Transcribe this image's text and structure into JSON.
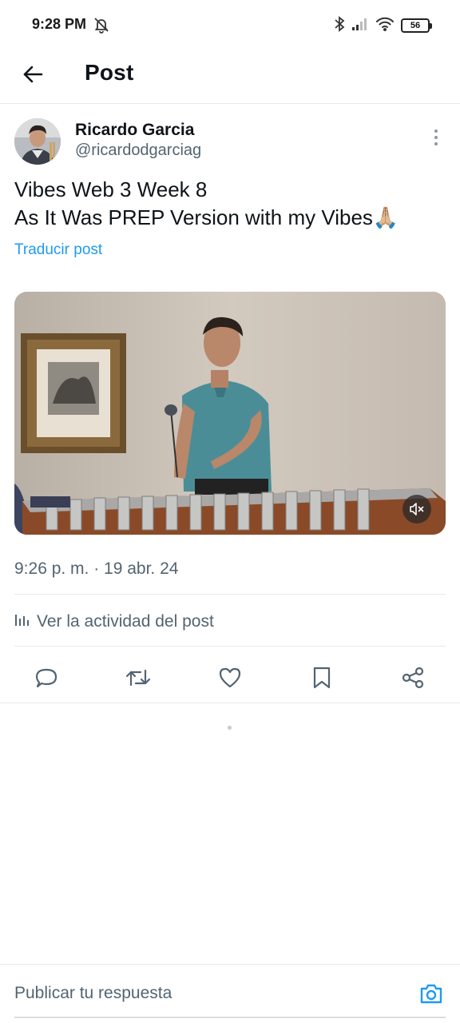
{
  "status_bar": {
    "time": "9:28 PM",
    "battery": "56",
    "icons": [
      "alarm-off-icon",
      "bluetooth-icon",
      "signal-icon",
      "wifi-icon",
      "battery-icon"
    ]
  },
  "header": {
    "title": "Post",
    "back_icon": "arrow-left-icon"
  },
  "post": {
    "author_name": "Ricardo Garcia",
    "author_handle": "@ricardodgarciag",
    "text_line1": "Vibes Web 3 Week 8",
    "text_line2": "As It Was PREP Version with my Vibes🙏🏼",
    "translate_label": "Traducir post",
    "timestamp": "9:26 p. m. · 19 abr. 24",
    "activity_label": "Ver la actividad del post"
  },
  "actions": {
    "icons": [
      "reply-icon",
      "repost-icon",
      "like-icon",
      "bookmark-icon",
      "share-icon"
    ]
  },
  "reply_bar": {
    "placeholder": "Publicar tu respuesta",
    "camera_icon": "camera-icon"
  },
  "colors": {
    "link": "#1d9bf0",
    "secondary_text": "#536471",
    "divider": "#e6e9eb"
  }
}
